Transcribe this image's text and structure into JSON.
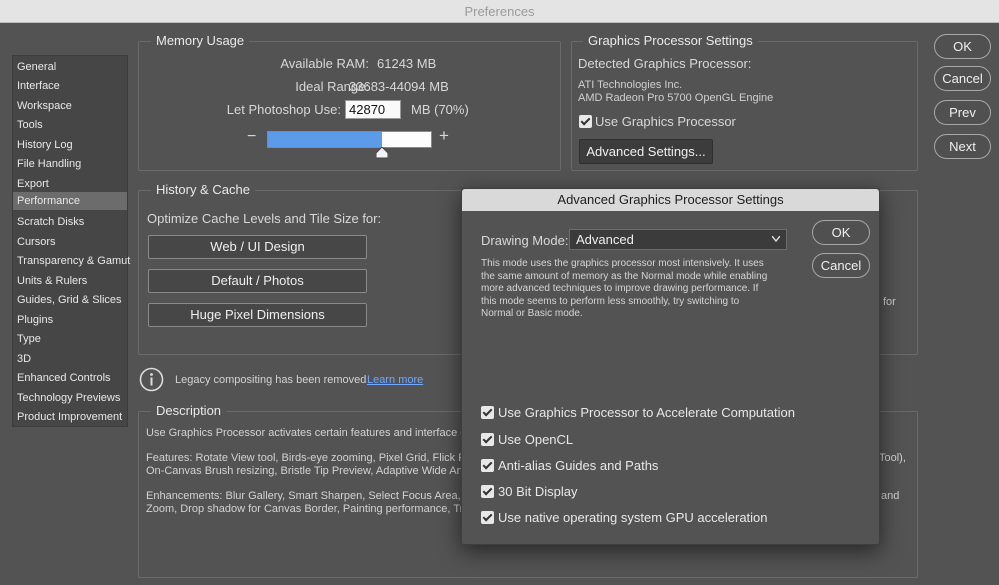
{
  "window": {
    "title": "Preferences"
  },
  "sidebar": {
    "items": [
      {
        "label": "General"
      },
      {
        "label": "Interface"
      },
      {
        "label": "Workspace"
      },
      {
        "label": "Tools"
      },
      {
        "label": "History Log"
      },
      {
        "label": "File Handling"
      },
      {
        "label": "Export"
      },
      {
        "label": "Performance",
        "selected": true
      },
      {
        "label": "Scratch Disks"
      },
      {
        "label": "Cursors"
      },
      {
        "label": "Transparency & Gamut"
      },
      {
        "label": "Units & Rulers"
      },
      {
        "label": "Guides, Grid & Slices"
      },
      {
        "label": "Plugins"
      },
      {
        "label": "Type"
      },
      {
        "label": "3D"
      },
      {
        "label": "Enhanced Controls"
      },
      {
        "label": "Technology Previews"
      },
      {
        "label": "Product Improvement"
      }
    ]
  },
  "memory": {
    "title": "Memory Usage",
    "available_label": "Available RAM:",
    "available_value": "61243 MB",
    "ideal_label": "Ideal Range:",
    "ideal_value": "33683-44094 MB",
    "use_label": "Let Photoshop Use:",
    "use_value": "42870",
    "use_suffix": "MB (70%)",
    "slider_fraction": 0.7,
    "minus": "−",
    "plus": "+"
  },
  "gpu": {
    "title": "Graphics Processor Settings",
    "detected_label": "Detected Graphics Processor:",
    "vendor": "ATI Technologies Inc.",
    "model": "AMD Radeon Pro 5700 OpenGL Engine",
    "use_gpu_label": "Use Graphics Processor",
    "use_gpu_checked": true,
    "advanced_button": "Advanced Settings..."
  },
  "history": {
    "title": "History & Cache",
    "optimize_label": "Optimize Cache Levels and Tile Size for:",
    "buttons": [
      "Web / UI Design",
      "Default / Photos",
      "Huge Pixel Dimensions"
    ],
    "right_fragment": "for"
  },
  "legacy": {
    "text": "Legacy compositing has been removed",
    "link": "Learn more",
    "link_color": "#6fa8ff"
  },
  "description": {
    "title": "Description",
    "line1": "Use Graphics Processor activates certain features and interface en",
    "line2": "Features: Rotate View tool, Birds-eye zooming, Pixel Grid, Flick Pan",
    "line2_right": "Tool),",
    "line3": "On-Canvas Brush resizing, Bristle Tip Preview, Adaptive Wide Angle",
    "line4": "Enhancements: Blur Gallery, Smart Sharpen, Select Focus Area, and",
    "line4_right": "and",
    "line5": "Zoom, Drop shadow for Canvas Border, Painting performance, Trans"
  },
  "actions": {
    "ok": "OK",
    "cancel": "Cancel",
    "prev": "Prev",
    "next": "Next"
  },
  "dialog": {
    "title": "Advanced Graphics Processor Settings",
    "drawing_mode_label": "Drawing Mode:",
    "drawing_mode_value": "Advanced",
    "ok": "OK",
    "cancel": "Cancel",
    "description_lines": [
      "This mode uses the graphics processor most intensively.  It uses",
      "the same amount of memory as the Normal mode while enabling",
      "more advanced techniques to improve drawing performance.  If",
      "this mode seems to perform less smoothly, try switching to",
      "Normal or Basic mode."
    ],
    "options": [
      {
        "label": "Use Graphics Processor to Accelerate Computation",
        "checked": true
      },
      {
        "label": "Use OpenCL",
        "checked": true
      },
      {
        "label": "Anti-alias Guides and Paths",
        "checked": true
      },
      {
        "label": "30 Bit Display",
        "checked": true
      },
      {
        "label": "Use native operating system GPU acceleration",
        "checked": true
      }
    ]
  },
  "colors": {
    "accent_blue": "#5b9bea",
    "panel_bg": "#535353"
  }
}
